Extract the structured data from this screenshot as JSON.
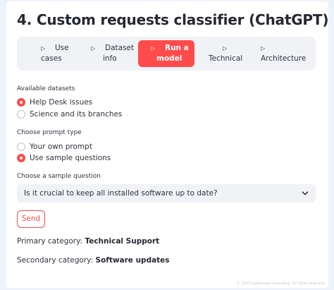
{
  "page": {
    "title": "4. Custom requests classifier (ChatGPT)"
  },
  "tabs": [
    {
      "line1": "Use",
      "line2": "cases",
      "active": false
    },
    {
      "line1": "Dataset",
      "line2": "info",
      "active": false
    },
    {
      "line1": "Run a",
      "line2": "model",
      "active": true
    },
    {
      "line1": "",
      "line2": "Technical",
      "active": false
    },
    {
      "line1": "",
      "line2": "Architecture",
      "active": false
    }
  ],
  "datasets": {
    "label": "Available datasets",
    "options": [
      "Help Desk issues",
      "Science and its branches"
    ],
    "selected_index": 0
  },
  "prompt_type": {
    "label": "Choose prompt type",
    "options": [
      "Your own prompt",
      "Use sample questions"
    ],
    "selected_index": 1
  },
  "sample_question": {
    "label": "Choose a sample question",
    "value": "Is it crucial to keep all installed software up to date?"
  },
  "send_button": {
    "label": "Send"
  },
  "results": {
    "primary_label": "Primary category:",
    "primary_value": "Technical Support",
    "secondary_label": "Secondary category:",
    "secondary_value": "Software updates"
  },
  "footer": {
    "text": "© 2023 Lakehouse Consulting. All rights reserved."
  },
  "colors": {
    "accent": "#ff4b4b",
    "background": "#eef3fb",
    "panel": "#f0f2f6"
  }
}
